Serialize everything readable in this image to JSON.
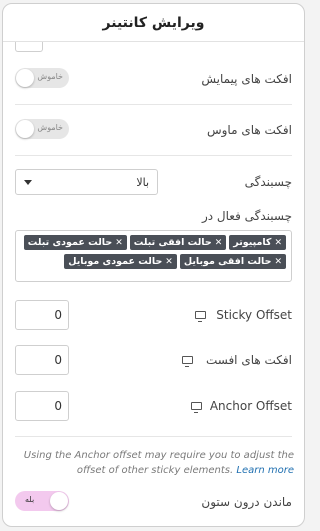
{
  "header": {
    "title": "ویرایش کانتینر"
  },
  "settings": {
    "scroll_effects": {
      "label": "افکت های پیمایش",
      "toggle_text": "خاموش"
    },
    "mouse_effects": {
      "label": "افکت های ماوس",
      "toggle_text": "خاموش"
    },
    "sticky": {
      "label": "چسبندگی",
      "value": "بالا"
    },
    "sticky_on": {
      "label": "چسبندگی فعال در",
      "tags": [
        {
          "text": "کامپیوتر"
        },
        {
          "text": "حالت افقی تبلت"
        },
        {
          "text": "حالت عمودی تبلت"
        },
        {
          "text": "حالت افقی موبایل"
        },
        {
          "text": "حالت عمودی موبایل"
        }
      ]
    },
    "sticky_offset": {
      "label": "Sticky Offset",
      "value": "0"
    },
    "effects_offset": {
      "label": "افکت های افست",
      "value": "0"
    },
    "anchor_offset": {
      "label": "Anchor Offset",
      "value": "0"
    },
    "anchor_note": {
      "text": "Using the Anchor offset may require you to adjust the offset of other sticky elements.",
      "link": "Learn more"
    },
    "stay_in_column": {
      "label": "ماندن درون ستون",
      "toggle_text": "بله"
    }
  }
}
